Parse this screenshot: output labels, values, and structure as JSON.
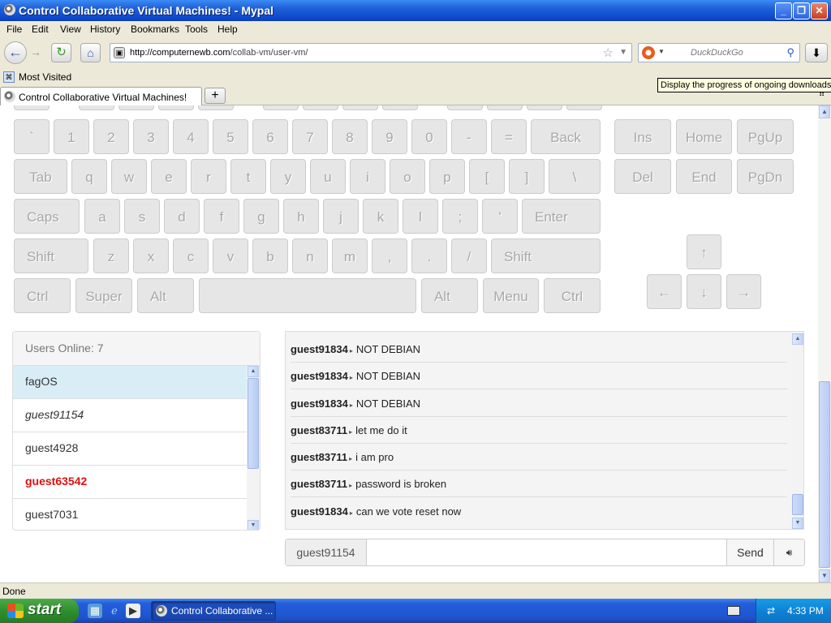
{
  "window": {
    "title": "Control Collaborative Virtual Machines! - Mypal"
  },
  "menu": [
    "File",
    "Edit",
    "View",
    "History",
    "Bookmarks",
    "Tools",
    "Help"
  ],
  "toolbar": {
    "url_host": "http://computernewb.com",
    "url_path": "/collab-vm/user-vm/",
    "search_placeholder": "DuckDuckGo"
  },
  "bookmarks": {
    "most_visited": "Most Visited"
  },
  "tooltip": "Display the progress of ongoing downloads",
  "tab": {
    "label": "Control Collaborative Virtual Machines!",
    "new_tab": "+"
  },
  "keyboard": {
    "row1": [
      "`",
      "1",
      "2",
      "3",
      "4",
      "5",
      "6",
      "7",
      "8",
      "9",
      "0",
      "-",
      "=",
      "Back"
    ],
    "row2": [
      "Tab",
      "q",
      "w",
      "e",
      "r",
      "t",
      "y",
      "u",
      "i",
      "o",
      "p",
      "[",
      "]",
      "\\"
    ],
    "row3": [
      "Caps",
      "a",
      "s",
      "d",
      "f",
      "g",
      "h",
      "j",
      "k",
      "l",
      ";",
      "'",
      "Enter"
    ],
    "row4": [
      "Shift",
      "z",
      "x",
      "c",
      "v",
      "b",
      "n",
      "m",
      ",",
      ".",
      "/",
      "Shift"
    ],
    "row5": [
      "Ctrl",
      "Super",
      "Alt",
      "",
      "Alt",
      "Menu",
      "Ctrl"
    ],
    "nav": [
      "Ins",
      "Home",
      "PgUp",
      "Del",
      "End",
      "PgDn"
    ],
    "arrows": [
      "↑",
      "←",
      "↓",
      "→"
    ]
  },
  "users": {
    "header": "Users Online: 7",
    "list": [
      "fagOS",
      "guest91154",
      "guest4928",
      "guest63542",
      "guest7031"
    ]
  },
  "chat": {
    "messages": [
      {
        "user": "guest91834",
        "text": "NOT DEBIAN"
      },
      {
        "user": "guest91834",
        "text": "NOT DEBIAN"
      },
      {
        "user": "guest91834",
        "text": "NOT DEBIAN"
      },
      {
        "user": "guest83711",
        "text": "let me do it"
      },
      {
        "user": "guest83711",
        "text": "i am pro"
      },
      {
        "user": "guest83711",
        "text": "password is broken"
      },
      {
        "user": "guest91834",
        "text": "can we vote reset now"
      }
    ],
    "username": "guest91154",
    "send_label": "Send",
    "input_value": ""
  },
  "status": {
    "text": "Done"
  },
  "taskbar": {
    "start_label": "start",
    "task_item": "Control Collaborative ...",
    "clock": "4:33 PM"
  },
  "colors": {
    "admin_user": "#dd1111",
    "selected_user_bg": "#d9edf7",
    "xp_blue": "#245edb"
  }
}
